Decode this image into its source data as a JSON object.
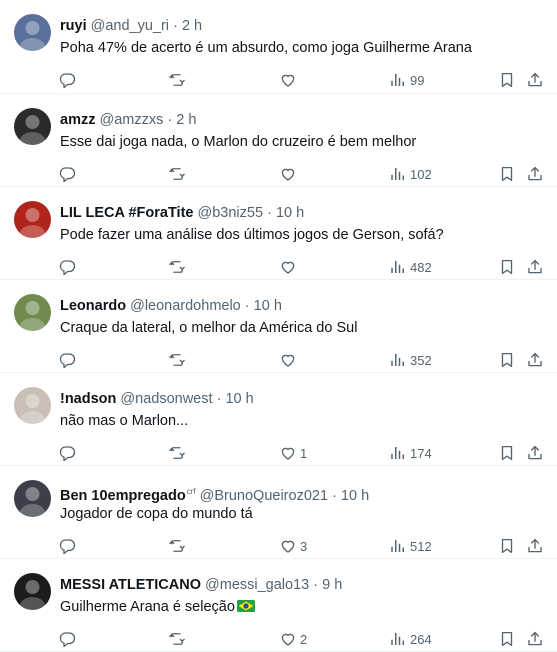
{
  "tweets": [
    {
      "name": "ruyi",
      "handle": "@and_yu_ri",
      "time": "2 h",
      "badge": "",
      "text": "Poha 47% de acerto é um absurdo, como joga Guilherme Arana",
      "likes": "",
      "views": "99",
      "avatar_color": "#5a6f9a",
      "flag": false
    },
    {
      "name": "amzz",
      "handle": "@amzzxs",
      "time": "2 h",
      "badge": "",
      "text": "Esse dai joga nada, o Marlon do cruzeiro é bem melhor",
      "likes": "",
      "views": "102",
      "avatar_color": "#2b2b2b",
      "flag": false
    },
    {
      "name": "LIL LECA #ForaTite",
      "handle": "@b3niz55",
      "time": "10 h",
      "badge": "",
      "text": "Pode fazer uma análise dos últimos jogos de Gerson, sofá?",
      "likes": "",
      "views": "482",
      "avatar_color": "#b0241c",
      "flag": false
    },
    {
      "name": "Leonardo",
      "handle": "@leonardohmelo",
      "time": "10 h",
      "badge": "",
      "text": "Craque da lateral, o melhor da América do Sul",
      "likes": "",
      "views": "352",
      "avatar_color": "#6f8b4e",
      "flag": false
    },
    {
      "name": "!nadson",
      "handle": "@nadsonwest",
      "time": "10 h",
      "badge": "",
      "text": "não mas o Marlon...",
      "likes": "1",
      "views": "174",
      "avatar_color": "#c9bfb4",
      "flag": false
    },
    {
      "name": "Ben 10empregado",
      "handle": "@BrunoQueiroz021",
      "time": "10 h",
      "badge": "crf",
      "text": "Jogador de copa do mundo tá",
      "likes": "3",
      "views": "512",
      "avatar_color": "#3a3f4a",
      "flag": false
    },
    {
      "name": "MESSI ATLETICANO",
      "handle": "@messi_galo13",
      "time": "9 h",
      "badge": "",
      "text": "Guilherme Arana é seleção",
      "likes": "2",
      "views": "264",
      "avatar_color": "#1c1c1c",
      "flag": true
    }
  ],
  "separator": "·",
  "icons": {
    "reply": "reply-icon",
    "retweet": "retweet-icon",
    "like": "heart-icon",
    "views": "views-icon",
    "bookmark": "bookmark-icon",
    "share": "share-icon"
  },
  "colors": {
    "text": "#0f1419",
    "muted": "#536471",
    "border": "#eff3f4"
  }
}
